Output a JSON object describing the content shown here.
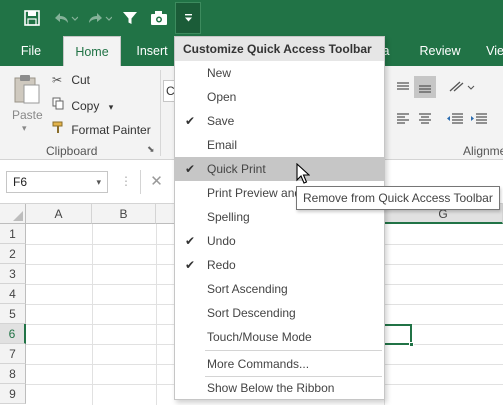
{
  "colors": {
    "excel_green": "#217346",
    "menu_hover": "#c6c6c6"
  },
  "qat": {
    "icons": [
      "save-icon",
      "undo-icon",
      "redo-icon",
      "filter-icon",
      "camera-icon",
      "customize-dropdown-icon"
    ]
  },
  "tabs": [
    "File",
    "Home",
    "Insert",
    "a",
    "Review",
    "Vie"
  ],
  "active_tab": "Home",
  "ribbon": {
    "paste": "Paste",
    "cut": "Cut",
    "copy": "Copy",
    "format_painter": "Format Painter",
    "clipboard": "Clipboard",
    "font_partial": "C",
    "alignment_partial": "Alignme"
  },
  "formula": {
    "namebox": "F6"
  },
  "grid": {
    "columns": [
      "A",
      "B",
      "G"
    ],
    "rows": [
      "1",
      "2",
      "3",
      "4",
      "5",
      "6",
      "7",
      "8",
      "9"
    ],
    "active_row": "6"
  },
  "menu": {
    "title": "Customize Quick Access Toolbar",
    "items": [
      {
        "label": "New",
        "checked": false
      },
      {
        "label": "Open",
        "checked": false
      },
      {
        "label": "Save",
        "checked": true
      },
      {
        "label": "Email",
        "checked": false
      },
      {
        "label": "Quick Print",
        "checked": true,
        "hover": true
      },
      {
        "label": "Print Preview and",
        "checked": false
      },
      {
        "label": "Spelling",
        "checked": false
      },
      {
        "label": "Undo",
        "checked": true
      },
      {
        "label": "Redo",
        "checked": true
      },
      {
        "label": "Sort Ascending",
        "checked": false
      },
      {
        "label": "Sort Descending",
        "checked": false
      },
      {
        "label": "Touch/Mouse Mode",
        "checked": false
      },
      {
        "label": "More Commands...",
        "checked": false
      },
      {
        "label": "Show Below the Ribbon",
        "checked": false
      }
    ]
  },
  "tooltip": "Remove from Quick Access Toolbar"
}
